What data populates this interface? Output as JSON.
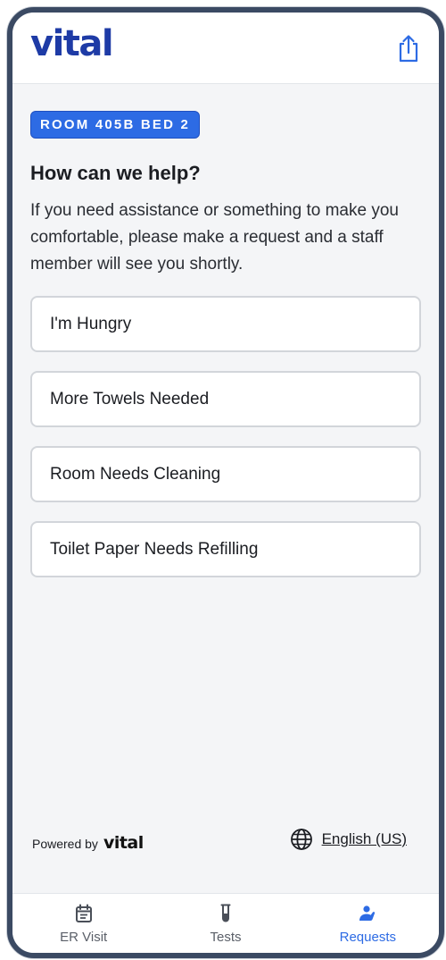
{
  "header": {
    "logo_text": "vital",
    "share_icon": "share-icon"
  },
  "room_badge": "ROOM 405B BED 2",
  "title": "How can we help?",
  "subtitle": "If you need assistance or something to make you comfortable, please make a request and a staff member will see you shortly.",
  "requests": [
    {
      "label": "I'm Hungry"
    },
    {
      "label": "More Towels Needed"
    },
    {
      "label": "Room Needs Cleaning"
    },
    {
      "label": "Toilet Paper Needs Refilling"
    }
  ],
  "footer": {
    "powered_by": "Powered by",
    "powered_logo": "vital",
    "language": "English (US)",
    "language_icon": "globe-icon"
  },
  "tabs": [
    {
      "label": "ER Visit",
      "icon": "calendar-icon",
      "active": false
    },
    {
      "label": "Tests",
      "icon": "test-tube-icon",
      "active": false
    },
    {
      "label": "Requests",
      "icon": "person-hand-icon",
      "active": true
    }
  ],
  "colors": {
    "brand": "#1e3ba6",
    "accent": "#2d6be4",
    "frame": "#3b4a63",
    "background": "#f4f5f7"
  }
}
